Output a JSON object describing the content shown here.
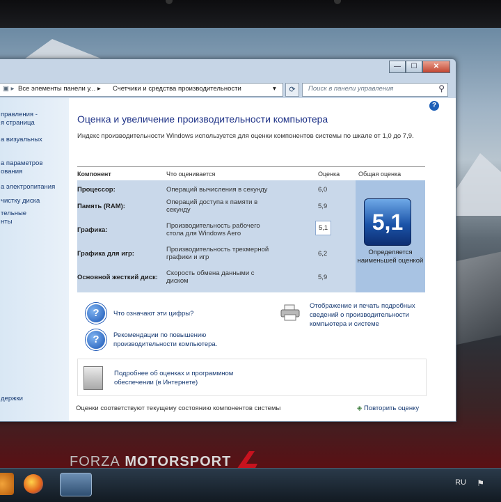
{
  "window": {
    "address_crumbs": [
      "Все элементы панели у...",
      "Счетчики и средства производительности"
    ],
    "search_placeholder": "Поиск в панели управления",
    "minimize_glyph": "—",
    "maximize_glyph": "☐",
    "close_glyph": "✕"
  },
  "sidebar": {
    "links": [
      "правления -\nя страница",
      "а визуальных\n",
      "а параметров\nования",
      "а электропитания",
      "чистку диска",
      "тельные\nнты"
    ],
    "bottom_link": "держки"
  },
  "main": {
    "title": "Оценка и увеличение производительности компьютера",
    "intro": "Индекс производительности Windows используется для оценки компонентов системы по шкале от 1,0 до 7,9.",
    "table_headers": {
      "component": "Компонент",
      "what": "Что оценивается",
      "score": "Оценка",
      "overall": "Общая оценка"
    },
    "rows": [
      {
        "component": "Процессор:",
        "description": "Операций вычисления в секунду",
        "score": "6,0"
      },
      {
        "component": "Память (RAM):",
        "description": "Операций доступа к памяти в секунду",
        "score": "5,9"
      },
      {
        "component": "Графика:",
        "description": "Производительность рабочего стола для Windows Aero",
        "score": "5,1"
      },
      {
        "component": "Графика для игр:",
        "description": "Производительность трехмерной графики и игр",
        "score": "6,2"
      },
      {
        "component": "Основной жесткий диск:",
        "description": "Скорость обмена данными с диском",
        "score": "5,9"
      }
    ],
    "overall_score": "5,1",
    "overall_caption": "Определяется наименьшей оценкой",
    "help_links": [
      "Что означают эти цифры?",
      "Рекомендации по повышению производительности компьютера."
    ],
    "print_link": "Отображение и печать подробных сведений о производительности компьютера и системе",
    "more_info_link": "Подробнее об оценках и программном обеспечении (в Интернете)",
    "status_text": "Оценки соответствуют текущему состоянию компонентов системы",
    "rerun_label": "Повторить оценку"
  },
  "wallpaper": {
    "brand_forza": "FORZA",
    "brand_motorsport": "MOTORSPORT",
    "brand_number": "4"
  },
  "taskbar": {
    "language": "RU"
  },
  "colors": {
    "accent": "#1e3287",
    "link": "#173a72",
    "table_bg": "#c9d8ea"
  }
}
